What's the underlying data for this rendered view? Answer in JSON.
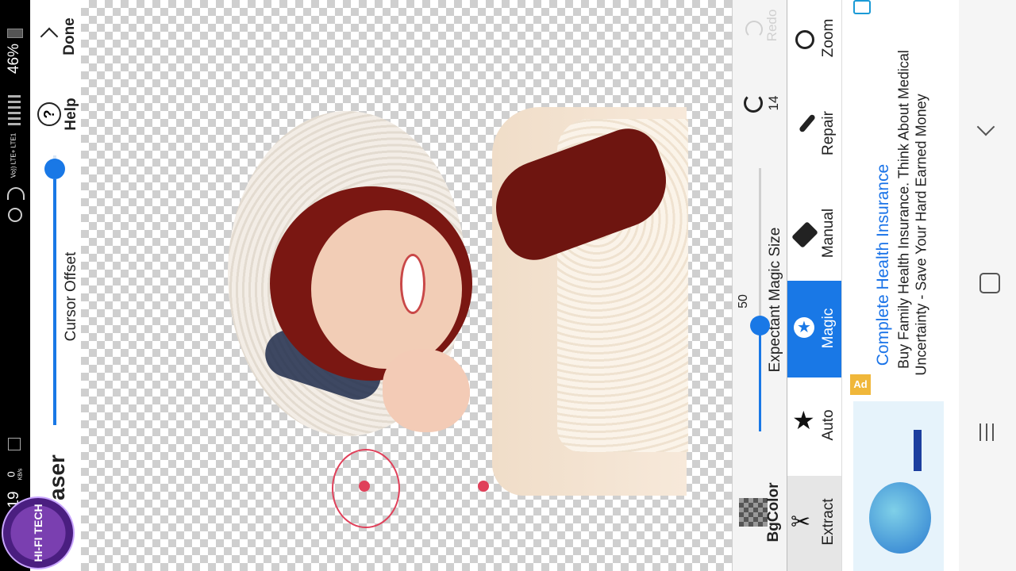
{
  "status_bar": {
    "battery": "46%",
    "network": "Vo)) LTE+ LTE1",
    "speed_value": "0",
    "speed_unit": "KB/s",
    "time_partial": "19"
  },
  "header": {
    "done_label": "Done",
    "help_label": "Help",
    "help_glyph": "?",
    "cursor_offset_label": "Cursor Offset",
    "cursor_offset_value": 0.2,
    "mode_label": "aser"
  },
  "canvas": {
    "watermark": "HI-FI TECH"
  },
  "tool_panel": {
    "redo_label": "Redo",
    "undo_count": "14",
    "magic_size_label": "Expectant Magic Size",
    "magic_size_value": "50",
    "tools": [
      {
        "id": "zoom",
        "label": "Zoom",
        "icon": "zoom-icon"
      },
      {
        "id": "repair",
        "label": "Repair",
        "icon": "brush-icon"
      },
      {
        "id": "manual",
        "label": "Manual",
        "icon": "eraser-icon"
      },
      {
        "id": "magic",
        "label": "Magic",
        "icon": "magic-star-icon",
        "active": true
      },
      {
        "id": "auto",
        "label": "Auto",
        "icon": "star-icon"
      },
      {
        "id": "extract",
        "label": "Extract",
        "icon": "scissors-icon"
      }
    ],
    "bgcolor_label": "BgColor"
  },
  "ad": {
    "badge": "Ad",
    "title": "Complete Health Insurance",
    "line1": "Buy Family Health Insurance. Think About Medical",
    "line2": "Uncertainty - Save Your Hard Earned Money"
  },
  "colors": {
    "accent": "#1978e6",
    "ad_title": "#1a73e8",
    "marker": "#e0405a"
  }
}
